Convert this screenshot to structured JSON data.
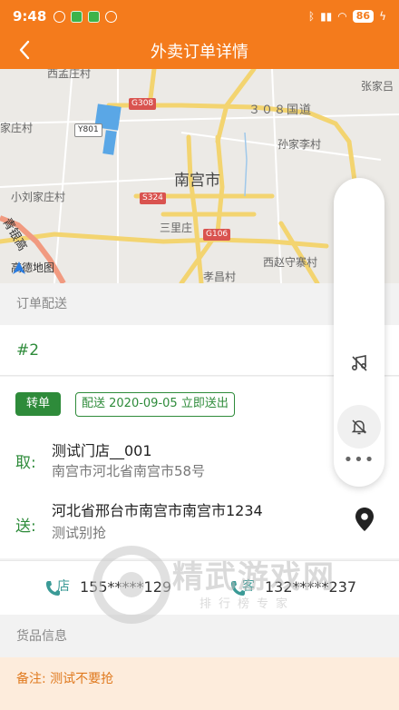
{
  "status_bar": {
    "time": "9:48",
    "battery": "86"
  },
  "header": {
    "title": "外卖订单详情"
  },
  "map": {
    "labels": {
      "xi_meng_zhuang": "西孟庄村",
      "zhang_jia": "张家吕",
      "g308": "G308",
      "guodao_308": "３０８国道",
      "jia_zhuang": "家庄村",
      "y801": "Y801",
      "sun_jia_li": "孙家李村",
      "nan_gong": "南宫市",
      "xiao_liu": "小刘家庄村",
      "s324": "S324",
      "san_li": "三里庄",
      "g106": "G106",
      "xi_zhao": "西赵守寨村",
      "xiao_chang": "孝昌村",
      "qing_yin": "青银高",
      "amap": "高德地图"
    }
  },
  "sections": {
    "delivery_title": "订单配送",
    "goods_title": "货品信息"
  },
  "order": {
    "number": "#2",
    "transfer_badge": "转单",
    "delivery_badge": "配送 2020-09-05 立即送出",
    "pickup_label": "取:",
    "pickup_name": "测试门店__001",
    "pickup_address": "南宫市河北省南宫市58号",
    "dropoff_label": "送:",
    "dropoff_address": "河北省邢台市南宫市南宫市1234",
    "dropoff_name": "测试别抢"
  },
  "contact": {
    "store_icon_text": "店",
    "store_phone": "155*****129",
    "customer_icon_text": "客",
    "customer_phone": "132*****237"
  },
  "remark": "备注:  测试不要抢",
  "watermark": {
    "main": "精武游戏网",
    "sub": "排行榜专家"
  },
  "colors": {
    "brand": "#f47b1c",
    "green": "#2e8b3a",
    "remark_bg": "#fdecdc"
  }
}
